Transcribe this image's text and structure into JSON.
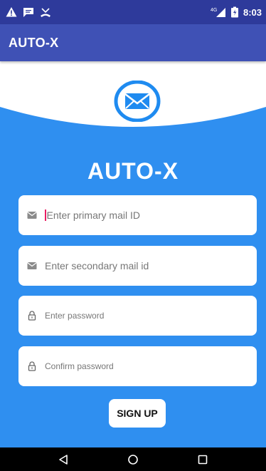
{
  "status_bar": {
    "time": "8:03",
    "network": "4G",
    "left_icons": [
      "warning-icon",
      "message-icon",
      "missed-call-icon"
    ],
    "right_icons": [
      "signal-icon",
      "battery-icon"
    ]
  },
  "app_bar": {
    "title": "AUTO-X"
  },
  "brand": {
    "title": "AUTO-X"
  },
  "form": {
    "primary_email": {
      "placeholder": "Enter primary mail ID",
      "icon": "mail-icon"
    },
    "secondary_email": {
      "placeholder": "Enter secondary mail id",
      "icon": "mail-icon"
    },
    "password": {
      "placeholder": "Enter password",
      "icon": "lock-icon"
    },
    "confirm_password": {
      "placeholder": "Confirm password",
      "icon": "lock-icon"
    },
    "signup_label": "SIGN UP"
  },
  "colors": {
    "status_bar": "#2e3a9b",
    "app_bar": "#3f51b5",
    "primary_blue": "#2f8ff0",
    "logo_blue": "#1f8bf0"
  },
  "nav_bar": {
    "buttons": [
      "back-icon",
      "home-icon",
      "recents-icon"
    ]
  }
}
